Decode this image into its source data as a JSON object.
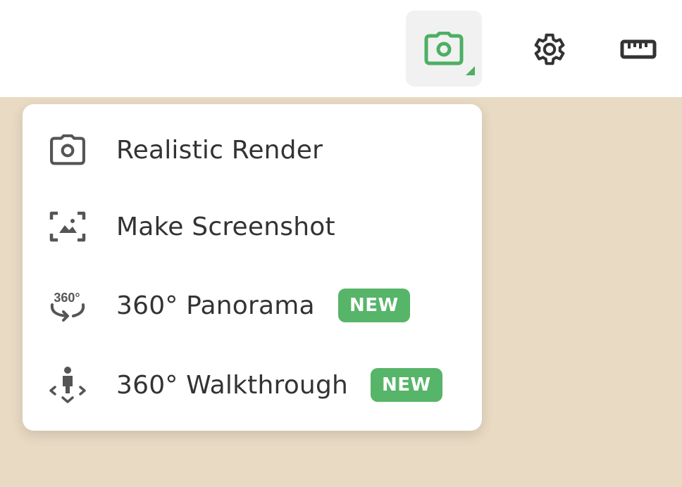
{
  "toolbar": {
    "icons": [
      "camera-icon",
      "gear-icon",
      "ruler-icon"
    ],
    "accent_color": "#4caf63"
  },
  "menu": {
    "items": [
      {
        "label": "Realistic Render",
        "icon": "camera-icon"
      },
      {
        "label": "Make Screenshot",
        "icon": "screenshot-icon"
      },
      {
        "label": "360° Panorama",
        "icon": "panorama-360-icon",
        "badge": "NEW"
      },
      {
        "label": "360° Walkthrough",
        "icon": "walkthrough-icon",
        "badge": "NEW"
      }
    ],
    "icon_text_360": "360°"
  },
  "colors": {
    "background": "#e8dac3",
    "badge": "#56b568",
    "icon": "#555555"
  }
}
